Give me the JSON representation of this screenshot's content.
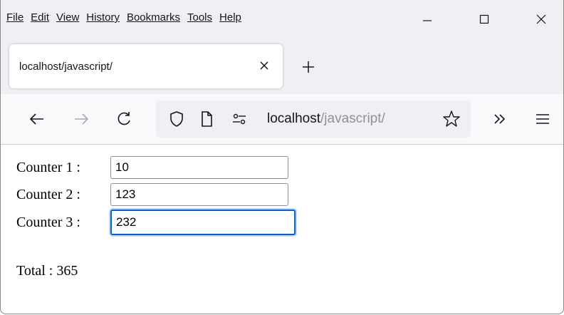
{
  "menu": {
    "items": [
      {
        "label": "File"
      },
      {
        "label": "Edit"
      },
      {
        "label": "View"
      },
      {
        "label": "History"
      },
      {
        "label": "Bookmarks"
      },
      {
        "label": "Tools"
      },
      {
        "label": "Help"
      }
    ]
  },
  "window_controls": {
    "minimize": "minimize-icon",
    "maximize": "maximize-icon",
    "close": "close-icon"
  },
  "tab": {
    "title": "localhost/javascript/"
  },
  "urlbar": {
    "host": "localhost",
    "path": "/javascript/"
  },
  "colors": {
    "accent": "#0060df",
    "chrome": "#f0f0f4"
  },
  "page": {
    "counters": [
      {
        "label": "Counter 1 :",
        "value": "10"
      },
      {
        "label": "Counter 2 :",
        "value": "123"
      },
      {
        "label": "Counter 3 :",
        "value": "232"
      }
    ],
    "total_label": "Total : 365"
  }
}
